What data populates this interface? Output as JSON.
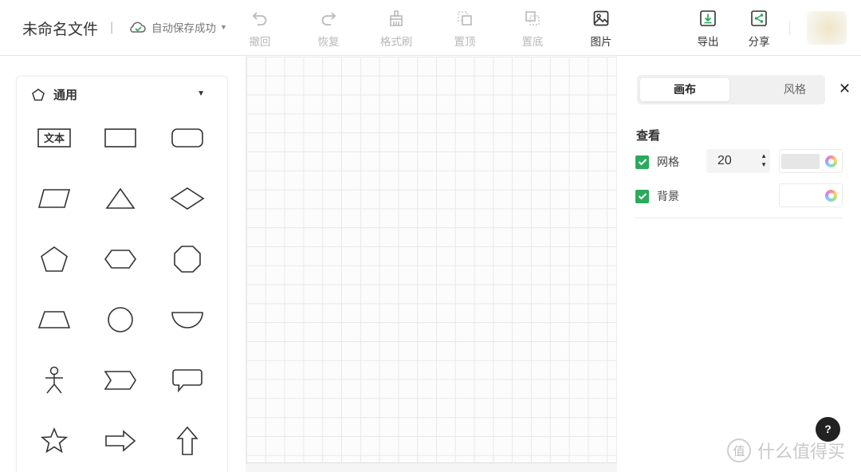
{
  "header": {
    "doc_title": "未命名文件",
    "separator": "|",
    "save_status": "自动保存成功",
    "tools": {
      "undo": "撤回",
      "redo": "恢复",
      "format_painter": "格式刷",
      "bring_to_front": "置顶",
      "send_to_back": "置底",
      "image": "图片",
      "export": "导出",
      "share": "分享"
    }
  },
  "left_panel": {
    "category": "通用",
    "text_shape_label": "文本",
    "shapes": [
      "text",
      "rectangle",
      "rounded-rectangle",
      "parallelogram",
      "triangle",
      "diamond",
      "pentagon",
      "hexagon",
      "octagon",
      "trapezoid",
      "circle",
      "half-circle",
      "actor",
      "step",
      "speech-bubble",
      "star",
      "arrow-right",
      "arrow-up"
    ]
  },
  "right_panel": {
    "tabs": [
      {
        "label": "画布",
        "active": true
      },
      {
        "label": "风格",
        "active": false
      }
    ],
    "section_title": "查看",
    "grid": {
      "label": "网格",
      "checked": true,
      "size": "20",
      "color": "#e6e6e6"
    },
    "background": {
      "label": "背景",
      "checked": true,
      "color": "#ffffff"
    }
  },
  "help_label": "?",
  "watermark": {
    "text": "什么值得买",
    "badge": "值"
  },
  "colors": {
    "accent": "#2aaa5c",
    "export_icon": "#2aaa5c"
  }
}
